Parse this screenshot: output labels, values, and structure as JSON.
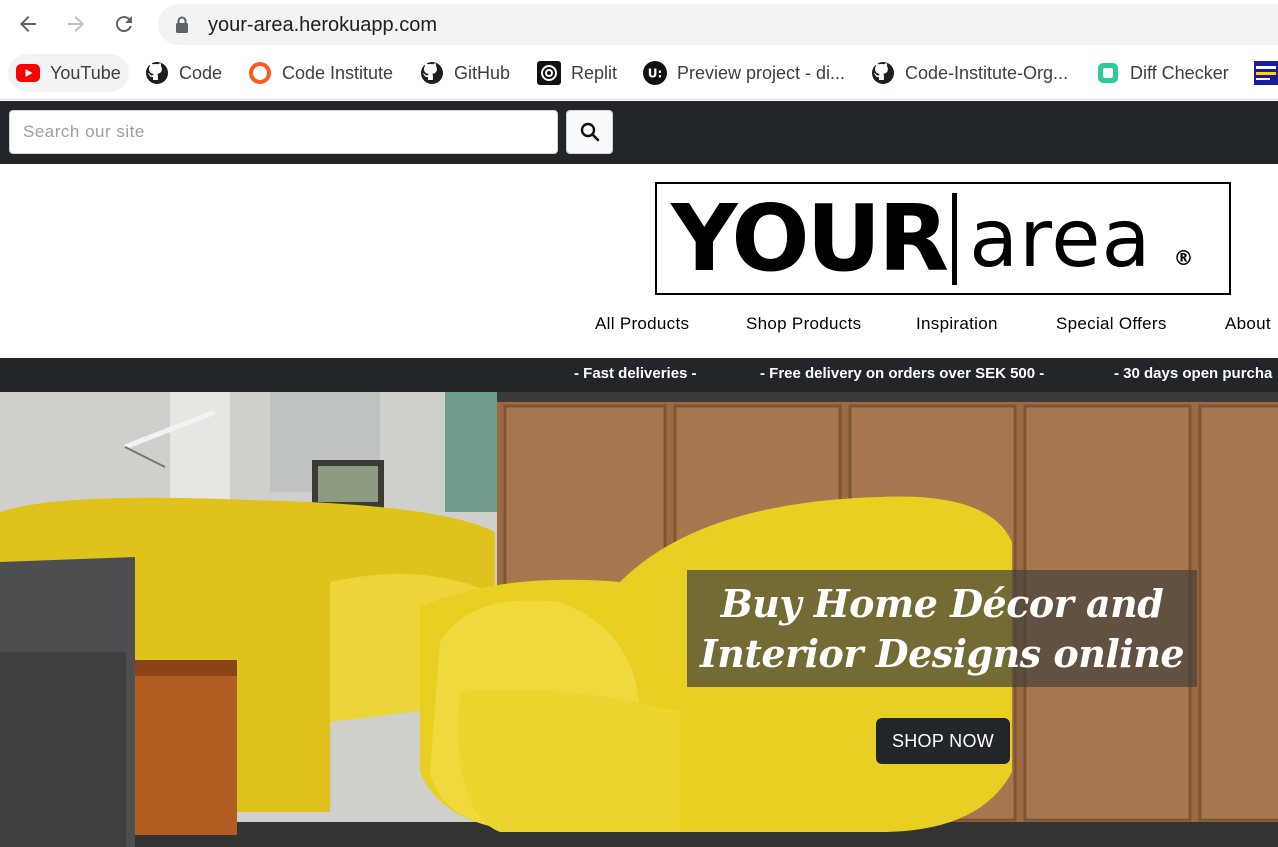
{
  "browser": {
    "url": "your-area.herokuapp.com",
    "bookmarks": [
      {
        "label": "YouTube",
        "icon": "youtube-icon"
      },
      {
        "label": "Code",
        "icon": "github-icon"
      },
      {
        "label": "Code Institute",
        "icon": "code-institute-icon"
      },
      {
        "label": "GitHub",
        "icon": "github-icon"
      },
      {
        "label": "Replit",
        "icon": "replit-icon"
      },
      {
        "label": "Preview project - di...",
        "icon": "ui-icon"
      },
      {
        "label": "Code-Institute-Org...",
        "icon": "github-icon"
      },
      {
        "label": "Diff Checker",
        "icon": "diffchecker-icon"
      }
    ]
  },
  "search": {
    "placeholder": "Search our site"
  },
  "logo": {
    "your": "YOUR",
    "area": "area",
    "reg": "®"
  },
  "nav": {
    "items": [
      "All Products",
      "Shop Products",
      "Inspiration",
      "Special Offers",
      "About"
    ]
  },
  "promo": {
    "items": [
      "-  Fast deliveries  -",
      "-  Free delivery on orders over SEK 500  -",
      "-  30 days open purcha"
    ]
  },
  "hero": {
    "line1": "Buy Home Décor and",
    "line2": "Interior Designs online",
    "button": "SHOP NOW"
  },
  "colors": {
    "dark": "#222529",
    "accent_yellow": "#e8d02a"
  }
}
